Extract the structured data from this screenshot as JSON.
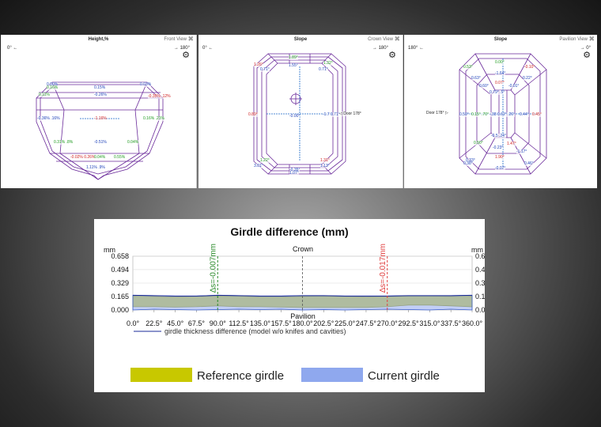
{
  "panels": [
    {
      "title": "Height,%",
      "view": "Front View",
      "range_left": "0° ←",
      "range_right": "→ 180°",
      "labels": [
        {
          "t": "0.00%",
          "c": "b"
        },
        {
          "t": "0.16%",
          "c": "g"
        },
        {
          "t": "0.15%",
          "c": "b"
        },
        {
          "t": "0.03%",
          "c": "b"
        },
        {
          "t": "0.11%",
          "c": "g"
        },
        {
          "t": "-0.26%",
          "c": "b"
        },
        {
          "t": "-0.35% .12%",
          "c": "r"
        },
        {
          "t": "-0.36% .16%",
          "c": "b"
        },
        {
          "t": "-1.16%",
          "c": "r"
        },
        {
          "t": "0.16% .21%",
          "c": "g"
        },
        {
          "t": "0.31% .8%",
          "c": "g"
        },
        {
          "t": "-0.51%",
          "c": "b"
        },
        {
          "t": "0.04%",
          "c": "g"
        },
        {
          "t": "-0.02% 0.26%",
          "c": "r"
        },
        {
          "t": "0.04%",
          "c": "g"
        },
        {
          "t": "0.55%",
          "c": "g"
        },
        {
          "t": "1.11% .9%",
          "c": "b"
        }
      ]
    },
    {
      "title": "Slope",
      "view": "Crown View",
      "range_left": "0° ←",
      "range_right": "→ 180°",
      "labels": [
        {
          "t": "1.89°",
          "c": "g"
        },
        {
          "t": "1.26°",
          "c": "r"
        },
        {
          "t": "1.55°",
          "c": "b"
        },
        {
          "t": "1.32°",
          "c": "g"
        },
        {
          "t": "0.71°",
          "c": "b"
        },
        {
          "t": "0.71°",
          "c": "b"
        },
        {
          "t": "0.89°",
          "c": "r"
        },
        {
          "t": "-0.00°",
          "c": "b"
        },
        {
          "t": "-1.7 0.71°",
          "c": "b"
        },
        {
          "t": "◁  Door 178°",
          "c": "k"
        },
        {
          "t": "1.22°",
          "c": "g"
        },
        {
          "t": "3.01°",
          "c": "b"
        },
        {
          "t": "-0.35°",
          "c": "b"
        },
        {
          "t": "1.31°",
          "c": "r"
        },
        {
          "t": "1.13°",
          "c": "b"
        },
        {
          "t": "1.07°",
          "c": "b"
        }
      ]
    },
    {
      "title": "Slope",
      "view": "Pavilion View",
      "range_left": "180° ←",
      "range_right": "→ 0°",
      "labels": [
        {
          "t": "0.00°",
          "c": "g"
        },
        {
          "t": "-0.10°",
          "c": "r"
        },
        {
          "t": "0.53°",
          "c": "g"
        },
        {
          "t": "-1.64°",
          "c": "b"
        },
        {
          "t": "0.63°",
          "c": "b"
        },
        {
          "t": "0.22°",
          "c": "b"
        },
        {
          "t": "0.60°",
          "c": "b"
        },
        {
          "t": "0.07°",
          "c": "r"
        },
        {
          "t": "-0.01°",
          "c": "b"
        },
        {
          "t": "0.79° .5°",
          "c": "b"
        },
        {
          "t": "Door 178°  ▷",
          "c": "k"
        },
        {
          "t": "0.50°",
          "c": "b"
        },
        {
          "t": "0.15° .70°",
          "c": "g"
        },
        {
          "t": "-.38 0.62° .26°",
          "c": "b"
        },
        {
          "t": "0.44°",
          "c": "b"
        },
        {
          "t": "0.45°",
          "c": "r"
        },
        {
          "t": "-0.5 .24°",
          "c": "b"
        },
        {
          "t": "0.50°",
          "c": "g"
        },
        {
          "t": "1.47°",
          "c": "r"
        },
        {
          "t": "-0.23°",
          "c": "b"
        },
        {
          "t": "-1.17°",
          "c": "b"
        },
        {
          "t": "0.33°",
          "c": "b"
        },
        {
          "t": "1.90°",
          "c": "r"
        },
        {
          "t": "0.38°",
          "c": "b"
        },
        {
          "t": "0.46°",
          "c": "b"
        },
        {
          "t": "-0.07°",
          "c": "b"
        }
      ]
    }
  ],
  "chart_data": {
    "type": "area",
    "title": "Girdle difference (mm)",
    "ylabel": "mm",
    "top_label": "Crown",
    "bottom_label": "Pavilion",
    "ylim": [
      0,
      0.658
    ],
    "yticks": [
      "0.658",
      "0.494",
      "0.329",
      "0.165",
      "0.000"
    ],
    "xticks": [
      "0.0°",
      "22.5°",
      "45.0°",
      "67.5°",
      "90.0°",
      "112.5°",
      "135.0°",
      "157.5°",
      "180.0°",
      "202.5°",
      "225.0°",
      "247.5°",
      "270.0°",
      "292.5°",
      "315.0°",
      "337.5°",
      "360.0°"
    ],
    "markers": [
      {
        "x": 90.0,
        "label": "∆s=-0.007mm",
        "color": "#2a8a2a"
      },
      {
        "x": 270.0,
        "label": "∆s=-0.017mm",
        "color": "#e04040"
      }
    ],
    "note": "girdle thickness difference (model w/o knifes and cavities)",
    "x": [
      0,
      22.5,
      45,
      67.5,
      90,
      112.5,
      135,
      157.5,
      180,
      202.5,
      225,
      247.5,
      270,
      292.5,
      315,
      337.5,
      360
    ],
    "series": [
      {
        "name": "Reference girdle",
        "color": "#c8c800",
        "top": [
          0.17,
          0.165,
          0.16,
          0.165,
          0.17,
          0.17,
          0.16,
          0.16,
          0.165,
          0.17,
          0.165,
          0.16,
          0.165,
          0.17,
          0.17,
          0.165,
          0.17
        ],
        "bottom": [
          0.04,
          0.04,
          0.035,
          0.04,
          0.05,
          0.04,
          0.04,
          0.035,
          0.03,
          0.03,
          0.03,
          0.03,
          0.04,
          0.06,
          0.06,
          0.05,
          0.04
        ]
      },
      {
        "name": "Current girdle",
        "color": "#8fa8ee",
        "top": [
          0.18,
          0.175,
          0.17,
          0.17,
          0.18,
          0.175,
          0.17,
          0.17,
          0.175,
          0.175,
          0.17,
          0.17,
          0.17,
          0.175,
          0.175,
          0.175,
          0.18
        ],
        "bottom": [
          0.0,
          0.01,
          0.005,
          0.0,
          0.005,
          0.01,
          0.005,
          0.01,
          0.0,
          0.005,
          0.0,
          0.005,
          0.01,
          0.005,
          0.0,
          0.01,
          0.0
        ]
      }
    ],
    "legend": [
      {
        "label": "Reference girdle",
        "color": "#c8c800"
      },
      {
        "label": "Current girdle",
        "color": "#8fa8ee"
      }
    ]
  }
}
